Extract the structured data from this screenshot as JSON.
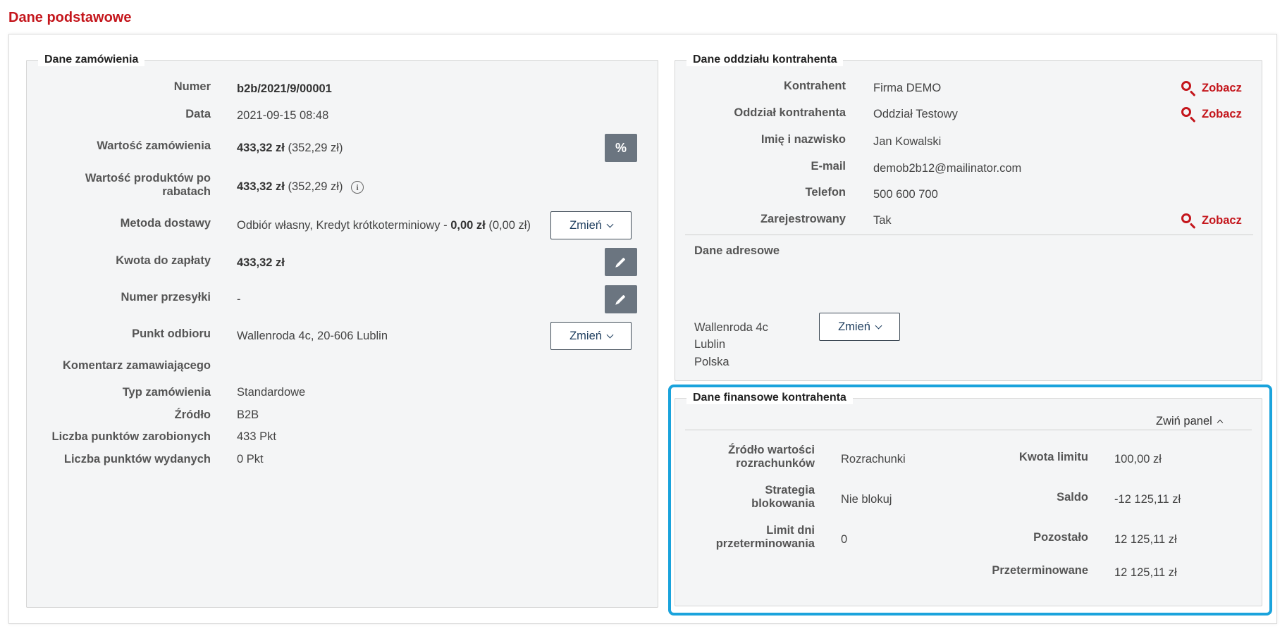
{
  "page_title": "Dane podstawowe",
  "order": {
    "legend": "Dane zamówienia",
    "numer_label": "Numer",
    "numer_value": "b2b/2021/9/00001",
    "data_label": "Data",
    "data_value": "2021-09-15 08:48",
    "wartosc_label": "Wartość zamówienia",
    "wartosc_bold": "433,32 zł",
    "wartosc_net": "(352,29 zł)",
    "discount_button": "%",
    "wartosc_prod_label_1": "Wartość produktów po",
    "wartosc_prod_label_2": "rabatach",
    "wartosc_prod_bold": "433,32 zł",
    "wartosc_prod_net": "(352,29 zł)",
    "info_icon": "i",
    "metoda_label": "Metoda dostawy",
    "metoda_text": "Odbiór własny, Kredyt krótkoterminiowy -",
    "metoda_bold": "0,00 zł",
    "metoda_net": "(0,00 zł)",
    "zmien_label": "Zmień",
    "kwota_label": "Kwota do zapłaty",
    "kwota_value": "433,32 zł",
    "przesylka_label": "Numer przesyłki",
    "przesylka_value": "-",
    "punkt_label": "Punkt odbioru",
    "punkt_value": "Wallenroda 4c, 20-606 Lublin",
    "komentarz_label": "Komentarz zamawiającego",
    "typ_label": "Typ zamówienia",
    "typ_value": "Standardowe",
    "zrodlo_label": "Źródło",
    "zrodlo_value": "B2B",
    "pkt_zar_label": "Liczba punktów zarobionych",
    "pkt_zar_value": "433 Pkt",
    "pkt_wyd_label": "Liczba punktów wydanych",
    "pkt_wyd_value": "0 Pkt"
  },
  "branch": {
    "legend": "Dane oddziału kontrahenta",
    "kontrahent_label": "Kontrahent",
    "kontrahent_value": "Firma DEMO",
    "oddzial_label": "Oddział kontrahenta",
    "oddzial_value": "Oddział Testowy",
    "imie_label": "Imię i nazwisko",
    "imie_value": "Jan Kowalski",
    "email_label": "E-mail",
    "email_value": "demob2b12@mailinator.com",
    "telefon_label": "Telefon",
    "telefon_value": "500 600 700",
    "zarej_label": "Zarejestrowany",
    "zarej_value": "Tak",
    "zobacz_label": "Zobacz",
    "adres_heading": "Dane adresowe",
    "adres_line1": "Wallenroda 4c",
    "adres_line2": "Lublin",
    "adres_line3": "Polska",
    "zmien_label": "Zmień"
  },
  "finance": {
    "legend": "Dane finansowe kontrahenta",
    "collapse_label": "Zwiń panel",
    "zrodlo_label_1": "Źródło wartości",
    "zrodlo_label_2": "rozrachunków",
    "zrodlo_value": "Rozrachunki",
    "strategia_label_1": "Strategia",
    "strategia_label_2": "blokowania",
    "strategia_value": "Nie blokuj",
    "limit_dni_label_1": "Limit dni",
    "limit_dni_label_2": "przeterminowania",
    "limit_dni_value": "0",
    "kwota_limitu_label": "Kwota limitu",
    "kwota_limitu_value": "100,00 zł",
    "saldo_label": "Saldo",
    "saldo_value": "-12 125,11 zł",
    "pozostalo_label": "Pozostało",
    "pozostalo_value": "12 125,11 zł",
    "przeterminowane_label": "Przeterminowane",
    "przeterminowane_value": "12 125,11 zł"
  },
  "colors": {
    "accent_red": "#c4161c",
    "highlight_blue": "#1aa3dc",
    "icon_button": "#6b7580",
    "panel_bg": "#f4f5f6"
  }
}
